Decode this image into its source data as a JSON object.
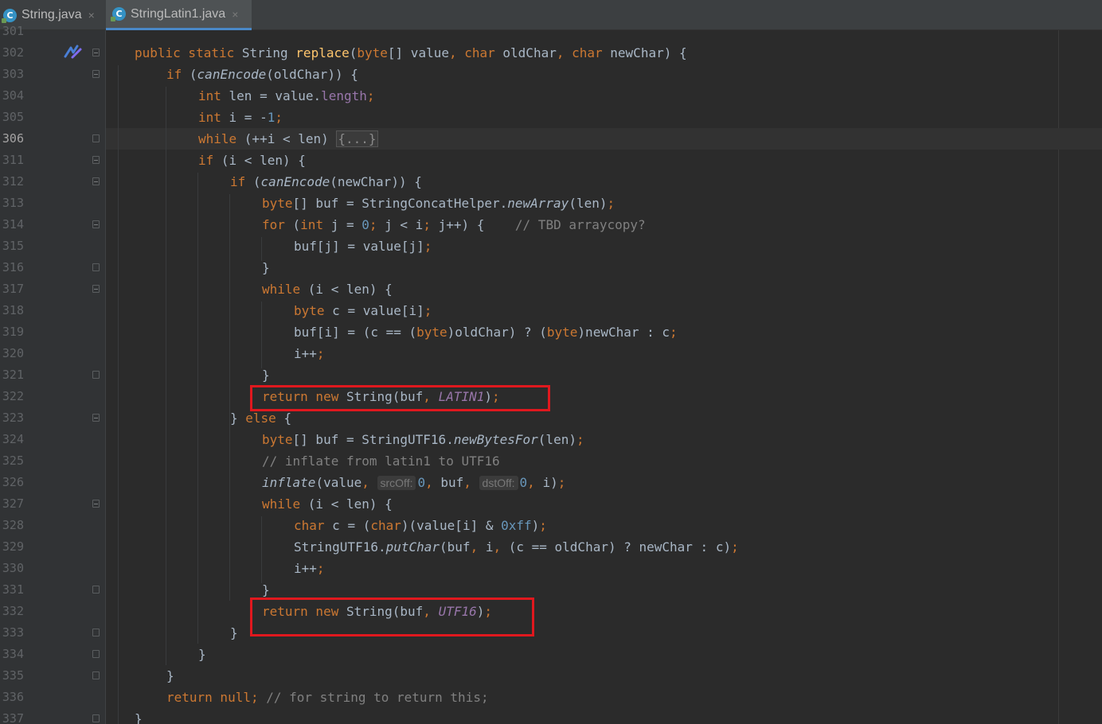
{
  "tabs": [
    {
      "label": "String.java",
      "active": false
    },
    {
      "label": "StringLatin1.java",
      "active": true
    }
  ],
  "tab_close_glyph": "×",
  "colors": {
    "keyword": "#cc7832",
    "method": "#ffc66d",
    "number": "#6897bb",
    "comment": "#808080",
    "field": "#9876aa",
    "highlight_box": "#e0181e"
  },
  "editor": {
    "line_numbers": [
      "301",
      "302",
      "303",
      "304",
      "305",
      "306",
      "311",
      "312",
      "313",
      "314",
      "315",
      "316",
      "317",
      "318",
      "319",
      "320",
      "321",
      "322",
      "323",
      "324",
      "325",
      "326",
      "327",
      "328",
      "329",
      "330",
      "331",
      "332",
      "333",
      "334",
      "335",
      "336",
      "337"
    ],
    "current_line": "306",
    "folded_region_placeholder": "{...}",
    "inlay_hints": {
      "src_off": "srcOff:",
      "dst_off": "dstOff:"
    },
    "highlighted_lines": [
      "322",
      "332"
    ],
    "gutter_marker_icon": "implementation-marker-icon"
  }
}
